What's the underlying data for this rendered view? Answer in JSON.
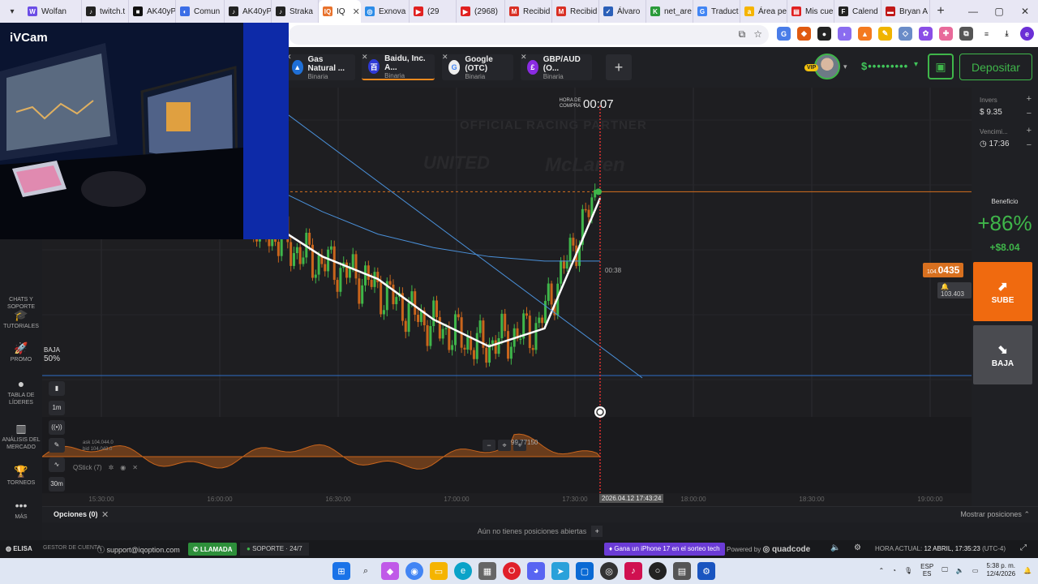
{
  "browser": {
    "tabs": [
      {
        "label": "Wolfan",
        "color": "#6b4de6",
        "glyph": "W"
      },
      {
        "label": "twitch.t",
        "color": "#222",
        "glyph": "♪"
      },
      {
        "label": "AK40yP",
        "color": "#111",
        "glyph": "■"
      },
      {
        "label": "Comun",
        "color": "#3b6de6",
        "glyph": "◐"
      },
      {
        "label": "AK40yP",
        "color": "#222",
        "glyph": "♪"
      },
      {
        "label": "Straka",
        "color": "#222",
        "glyph": "♪"
      },
      {
        "label": "IQ",
        "color": "#e8722c",
        "glyph": "IQ",
        "active": true
      },
      {
        "label": "Exnova",
        "color": "#2c8ce8",
        "glyph": "◎"
      },
      {
        "label": "(29",
        "color": "#e02020",
        "glyph": "▶"
      },
      {
        "label": "(2968)",
        "color": "#e02020",
        "glyph": "▶"
      },
      {
        "label": "Recibid",
        "color": "#d93025",
        "glyph": "M"
      },
      {
        "label": "Recibid",
        "color": "#d93025",
        "glyph": "M"
      },
      {
        "label": "Álvaro",
        "color": "#2b5fb8",
        "glyph": "✓"
      },
      {
        "label": "net_are",
        "color": "#2a9a3a",
        "glyph": "K"
      },
      {
        "label": "Traduct",
        "color": "#4285f4",
        "glyph": "G"
      },
      {
        "label": "Área pe",
        "color": "#f5b400",
        "glyph": "a"
      },
      {
        "label": "Mis cue",
        "color": "#e02020",
        "glyph": "▤"
      },
      {
        "label": "Calend",
        "color": "#222",
        "glyph": "F"
      },
      {
        "label": "Bryan A",
        "color": "#c01818",
        "glyph": "▬"
      }
    ],
    "window_controls": [
      "—",
      "▢",
      "✕"
    ]
  },
  "webcam": {
    "brand": "iVCam"
  },
  "assets": [
    {
      "name": "Gas Natural ...",
      "type": "Binaria",
      "icon_color": "#1f6fd6",
      "glyph": "▲"
    },
    {
      "name": "Baidu, Inc. A...",
      "type": "Binaria",
      "icon_color": "#2f3ad6",
      "glyph": "百",
      "active": true
    },
    {
      "name": "Google (OTC)",
      "type": "Binaria",
      "icon_color": "#eee",
      "glyph": "G"
    },
    {
      "name": "GBP/AUD (O...",
      "type": "Binaria",
      "icon_color": "#8a2be2",
      "glyph": "£"
    }
  ],
  "account": {
    "vip": "VIP",
    "balance": "$•••••••••",
    "deposit": "Depositar"
  },
  "sidebar": [
    {
      "label": "CHATS Y SOPORTE",
      "icon": "chat-icon",
      "glyph": ""
    },
    {
      "label": "TUTORIALES",
      "icon": "graduation-cap-icon",
      "glyph": "🎓"
    },
    {
      "label": "PROMO",
      "icon": "rocket-icon",
      "glyph": "🚀"
    },
    {
      "label": "TABLA DE LÍDERES",
      "icon": "leaderboard-icon",
      "glyph": "●"
    },
    {
      "label": "ANÁLISIS DEL MERCADO",
      "icon": "chart-bars-icon",
      "glyph": "▥"
    },
    {
      "label": "TORNEOS",
      "icon": "trophy-icon",
      "glyph": "🏆"
    },
    {
      "label": "MÁS",
      "icon": "more-dots-icon",
      "glyph": "•••"
    }
  ],
  "chart_tools": [
    "1m",
    "30m"
  ],
  "chart": {
    "timer_label": "HORA DE COMPRA",
    "timer": "00:07",
    "countdown": "00:38",
    "price_int": "104.",
    "price_dec": "0435",
    "alt_price": "103.403",
    "baja_label": "BAJA",
    "baja_pct": "50%",
    "ask": "ask 104.044.0",
    "bid": "bid 104.043.0",
    "indicator": "QStick (7)",
    "min_price": "99.77150",
    "date_tag": "2026.04.12 17:43:24",
    "sponsor": "OFFICIAL RACING PARTNER",
    "sponsor_a": "UNITED",
    "sponsor_b": "McLaren"
  },
  "chart_data": {
    "type": "line",
    "title": "",
    "x": [
      "15:30:00",
      "16:00:00",
      "16:30:00",
      "17:00:00",
      "17:30:00",
      "18:00:00",
      "18:30:00",
      "19:00:00"
    ],
    "series": [
      {
        "values": [
          104.9,
          104.6,
          103.4,
          102.6,
          102.1,
          101.2,
          100.6,
          101.0,
          103.9
        ]
      },
      {
        "values": [
          105.2,
          104.8,
          104.2,
          103.6,
          103.1,
          102.8,
          102.6,
          102.5,
          102.5
        ]
      }
    ],
    "current_price": 104.0435,
    "min_price": 99.7715,
    "ylim": [
      99.5,
      106
    ],
    "grid": true
  },
  "right_panel": {
    "invest_label": "Invers",
    "invest": "$ 9.35",
    "expiry_label": "Vencimi...",
    "expiry": "17:36",
    "profit_label": "Beneficio",
    "profit_pct": "+86%",
    "profit_usd": "+$8.04",
    "up": "SUBE",
    "down": "BAJA"
  },
  "bottom": {
    "options": "Opciones (0)",
    "show_positions": "Mostrar posiciones",
    "no_positions": "Aún no tienes posiciones abiertas"
  },
  "footer": {
    "user": "ELISA",
    "manager": "GESTOR DE CUENTA",
    "email": "support@iqoption.com",
    "call": "LLAMADA",
    "support": "SOPORTE",
    "support_hours": "24/7",
    "promo": "Gana un iPhone 17 en el sorteo tech",
    "powered": "Powered by",
    "powered_brand": "quadcode",
    "time_label": "HORA ACTUAL:",
    "time_value": "12 ABRIL, 17:35:23",
    "tz": "(UTC-4)"
  },
  "taskbar": {
    "lang": "ESP",
    "region": "ES",
    "time": "5:38 p. m.",
    "date": "12/4/2026"
  }
}
